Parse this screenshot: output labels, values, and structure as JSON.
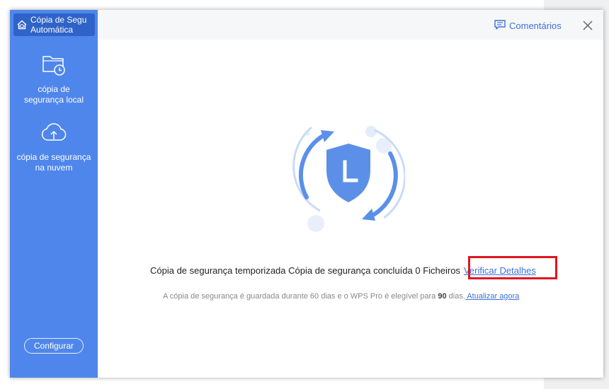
{
  "app": {
    "title_line1": "Cópia de Segu",
    "title_line2": "Automática"
  },
  "sidebar": {
    "items": [
      {
        "label_line1": "cópia de",
        "label_line2": "segurança local",
        "icon": "folder-clock-icon"
      },
      {
        "label_line1": "cópia de segurança",
        "label_line2": "na nuvem",
        "icon": "cloud-upload-icon"
      }
    ],
    "configure_label": "Configurar"
  },
  "topbar": {
    "feedback_label": "Comentários",
    "close_icon": "close-icon"
  },
  "main": {
    "illustration_icon": "shield-clock-icon",
    "status_text": "Cópia de segurança temporizada Cópia de segurança concluída 0 Ficheiros",
    "details_link": "Verificar Detalhes",
    "note_prefix": "A cópia de segurança é guardada durante 60 dias e o WPS Pro é elegível para",
    "note_days": "90",
    "note_suffix": "dias.",
    "upgrade_link": " Atualizar agora"
  },
  "colors": {
    "sidebar": "#4f86eb",
    "sidebar_header": "#2f63c8",
    "accent": "#3d72d6",
    "highlight": "#e0151f"
  }
}
